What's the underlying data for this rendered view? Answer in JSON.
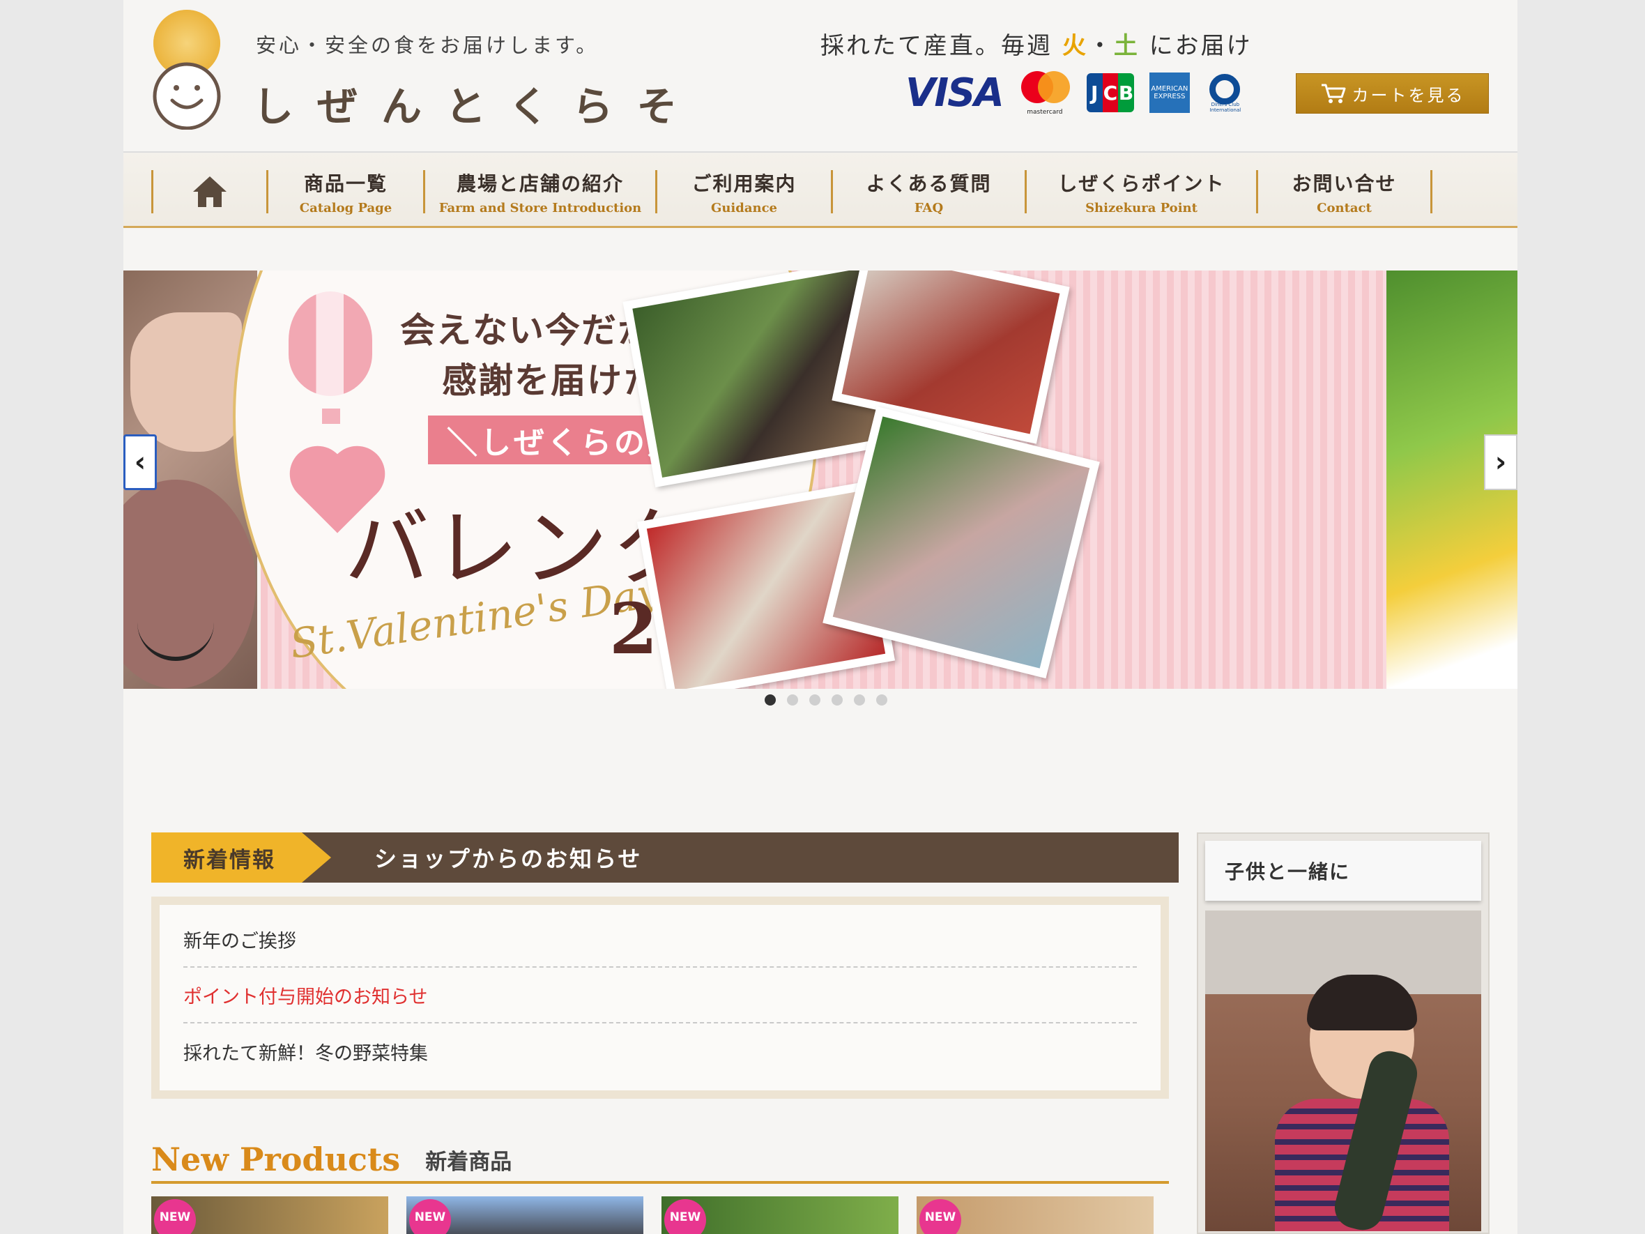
{
  "header": {
    "tagline": "安心・安全の食をお届けします。",
    "brand": "しぜんとくらそ",
    "delivery_prefix": "採れたて産直。毎週",
    "delivery_day1": "火",
    "delivery_sep": "・",
    "delivery_day2": "土",
    "delivery_suffix": "にお届け",
    "cards": {
      "visa": "VISA",
      "mastercard": "mastercard",
      "jcb": [
        "J",
        "C",
        "B"
      ],
      "amex": "AMERICAN EXPRESS",
      "diners": "Diners Club International"
    },
    "cart_label": "カートを見る"
  },
  "nav": {
    "items": [
      {
        "jp": "商品一覧",
        "en": "Catalog Page"
      },
      {
        "jp": "農場と店舗の紹介",
        "en": "Farm and Store Introduction"
      },
      {
        "jp": "ご利用案内",
        "en": "Guidance"
      },
      {
        "jp": "よくある質問",
        "en": "FAQ"
      },
      {
        "jp": "しぜくらポイント",
        "en": "Shizekura Point"
      },
      {
        "jp": "お問い合せ",
        "en": "Contact"
      }
    ]
  },
  "slider": {
    "line1": "会えない今だからこそ、",
    "line2": "感謝を届けたい！",
    "ribbon": "＼しぜくらの／",
    "headline": "バレンタイン",
    "script": "St.Valentine's Day",
    "year": "2021",
    "prev": "‹",
    "next": "›",
    "dots": 6,
    "active_dot": 0
  },
  "news": {
    "tag": "新着情報",
    "title": "ショップからのお知らせ",
    "items": [
      {
        "text": "新年のご挨拶",
        "color": "#333333"
      },
      {
        "text": "ポイント付与開始のお知らせ",
        "color": "#e03030"
      },
      {
        "text": "採れたて新鮮！冬の野菜特集",
        "color": "#333333"
      }
    ]
  },
  "new_products": {
    "title_en": "New Products",
    "title_jp": "新着商品",
    "badge": "NEW"
  },
  "sidebar": {
    "title": "子供と一緒に"
  },
  "colors": {
    "accent_gold": "#c89524",
    "nav_en": "#b47a1c",
    "news_head": "#5e4a3b",
    "news_tag": "#f0b429",
    "new_products": "#d98a1a",
    "badge": "#e8368f"
  }
}
